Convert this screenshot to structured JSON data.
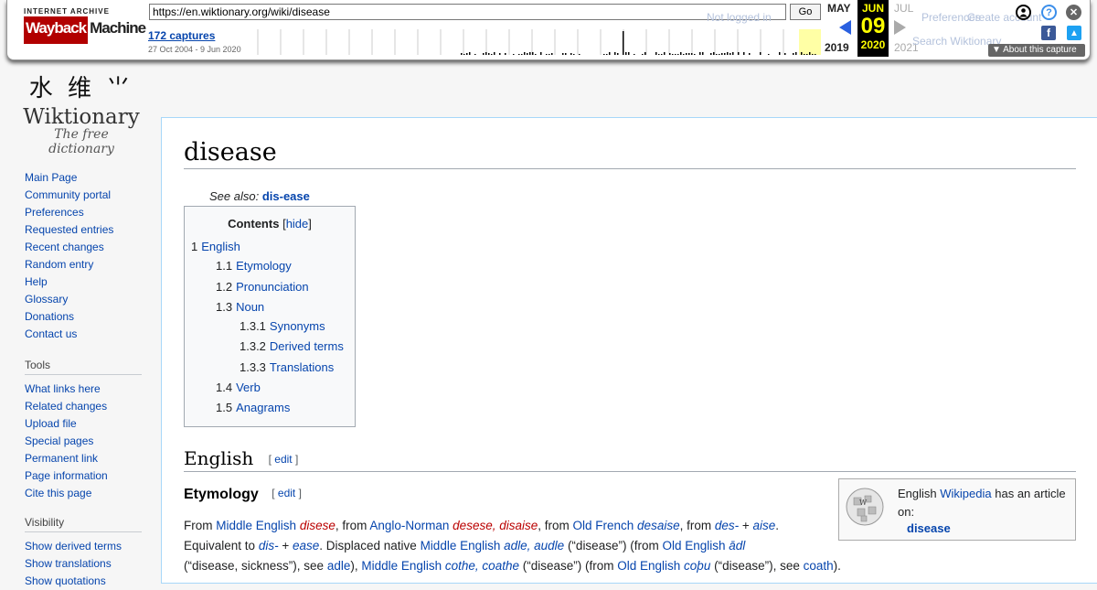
{
  "wayback": {
    "logo_top": "INTERNET ARCHIVE",
    "logo_way": "Wayback",
    "logo_machine": "Machine",
    "url": "https://en.wiktionary.org/wiki/disease",
    "go_label": "Go",
    "captures_label": "172 captures",
    "date_range": "27 Oct 2004 - 9 Jun 2020",
    "prev_month": "MAY",
    "prev_year": "2019",
    "cur_month": "JUN",
    "cur_day": "09",
    "cur_year": "2020",
    "next_month": "JUL",
    "next_year": "2021",
    "about_label": "About this capture",
    "icons": [
      "account-icon",
      "help-icon",
      "close-icon",
      "facebook-icon",
      "twitter-icon"
    ]
  },
  "behind_toolbar": {
    "not_logged_in": "Not logged in",
    "preferences": "Preferences",
    "create_account": "Create account",
    "search_wiktionary": "Search Wiktionary"
  },
  "sidebar": {
    "logo_glyphs": "水 维 ⺌",
    "logo_name": "Wiktionary",
    "logo_tagline": "The free dictionary",
    "nav": [
      "Main Page",
      "Community portal",
      "Preferences",
      "Requested entries",
      "Recent changes",
      "Random entry",
      "Help",
      "Glossary",
      "Donations",
      "Contact us"
    ],
    "tools_heading": "Tools",
    "tools": [
      "What links here",
      "Related changes",
      "Upload file",
      "Special pages",
      "Permanent link",
      "Page information",
      "Cite this page"
    ],
    "visibility_heading": "Visibility",
    "visibility": [
      "Show derived terms",
      "Show translations",
      "Show quotations"
    ]
  },
  "article": {
    "title": "disease",
    "see_also_label": "See also:",
    "see_also_link": "dis-ease",
    "toc": {
      "title": "Contents",
      "hide": "hide",
      "items": [
        {
          "num": "1",
          "label": "English",
          "level": 1
        },
        {
          "num": "1.1",
          "label": "Etymology",
          "level": 2
        },
        {
          "num": "1.2",
          "label": "Pronunciation",
          "level": 2
        },
        {
          "num": "1.3",
          "label": "Noun",
          "level": 2
        },
        {
          "num": "1.3.1",
          "label": "Synonyms",
          "level": 3
        },
        {
          "num": "1.3.2",
          "label": "Derived terms",
          "level": 3
        },
        {
          "num": "1.3.3",
          "label": "Translations",
          "level": 3
        },
        {
          "num": "1.4",
          "label": "Verb",
          "level": 2
        },
        {
          "num": "1.5",
          "label": "Anagrams",
          "level": 2
        }
      ]
    },
    "h2_english": "English",
    "h3_etymology": "Etymology",
    "edit_label": "edit",
    "wikipedia_box": {
      "pre": "English",
      "link": "Wikipedia",
      "post": "has an article",
      "post2": "on:",
      "article": "disease"
    },
    "etym_line1": {
      "t1": "From ",
      "l1": "Middle English",
      "r1": "disese",
      "t2": ", from ",
      "l2": "Anglo-Norman",
      "r2": "desese, disaise",
      "t3": ", from ",
      "l3": "Old French",
      "i3": "desaise",
      "t4": ", from ",
      "i4": "des-",
      "t5": " + ",
      "i5": "aise",
      "t6": "."
    },
    "etym_line2": {
      "t1": "Equivalent to ",
      "i1": "dis-",
      "t2": " + ",
      "i2": "ease",
      "t3": ". Displaced native ",
      "l3": "Middle English",
      "i3": "adle, audle",
      "t4": " (“disease”) (from ",
      "l4": "Old English",
      "i4": "ādl"
    },
    "etym_line3": {
      "t1": "(“disease, sickness”), see ",
      "l1": "adle",
      "t2": "), ",
      "l2": "Middle English",
      "i2": "cothe, coathe",
      "t3": " (“disease”) (from ",
      "l3": "Old English",
      "i3": "coþu",
      "t4": " (“disease”), see ",
      "l4": "coath",
      "t5": ")."
    }
  }
}
